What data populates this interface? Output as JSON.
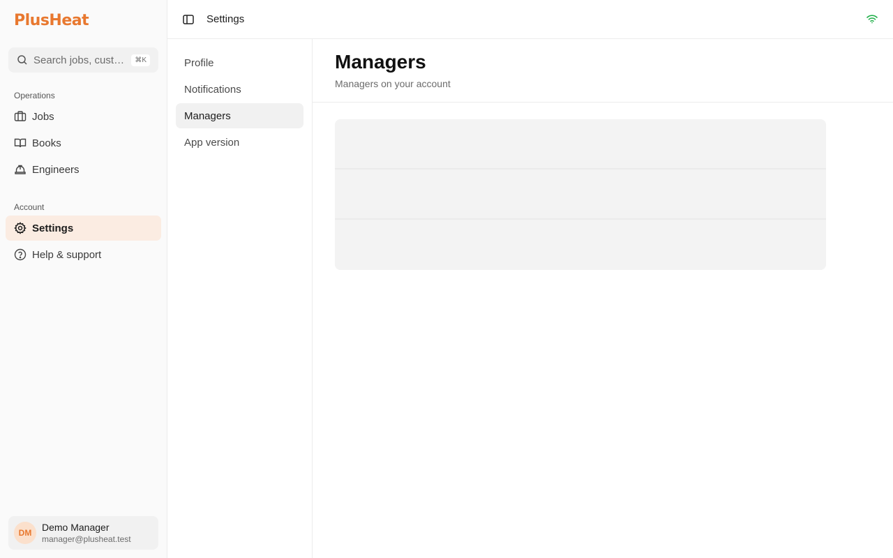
{
  "app": {
    "logo": "PlusHeat"
  },
  "search": {
    "placeholder": "Search jobs, custo...",
    "shortcut": "⌘K"
  },
  "sidebar": {
    "sections": [
      {
        "label": "Operations"
      },
      {
        "label": "Account"
      }
    ],
    "items": [
      {
        "label": "Jobs",
        "icon": "briefcase-icon"
      },
      {
        "label": "Books",
        "icon": "book-icon"
      },
      {
        "label": "Engineers",
        "icon": "hard-hat-icon"
      },
      {
        "label": "Settings",
        "icon": "gear-icon",
        "active": true
      },
      {
        "label": "Help & support",
        "icon": "help-circle-icon"
      }
    ]
  },
  "user": {
    "initials": "DM",
    "name": "Demo Manager",
    "email": "manager@plusheat.test"
  },
  "header": {
    "title": "Settings"
  },
  "settings_nav": {
    "items": [
      {
        "label": "Profile"
      },
      {
        "label": "Notifications"
      },
      {
        "label": "Managers",
        "active": true
      },
      {
        "label": "App version"
      }
    ]
  },
  "main": {
    "title": "Managers",
    "subtitle": "Managers on your account"
  },
  "colors": {
    "brand": "#e8782f",
    "active_bg": "#fbece2",
    "online": "#22b04b"
  }
}
